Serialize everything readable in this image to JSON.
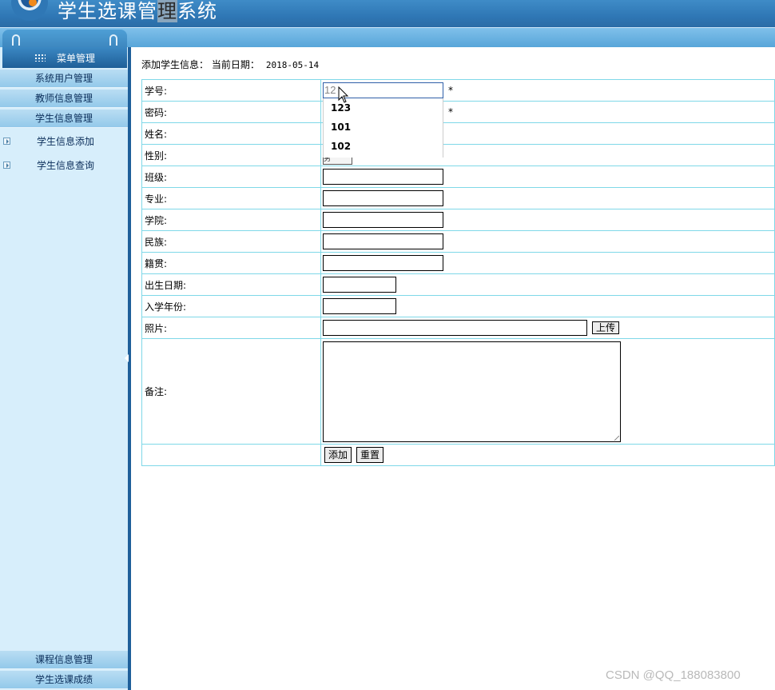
{
  "app": {
    "title_before": "学生选课管",
    "title_highlight": "理",
    "title_after": "系统"
  },
  "sidebar": {
    "menu_header": "菜单管理",
    "items": [
      {
        "label": "系统用户管理"
      },
      {
        "label": "教师信息管理"
      },
      {
        "label": "学生信息管理"
      }
    ],
    "sub_items": [
      {
        "label": "学生信息添加"
      },
      {
        "label": "学生信息查询"
      }
    ],
    "bottom_items": [
      {
        "label": "课程信息管理"
      },
      {
        "label": "学生选课成绩"
      }
    ]
  },
  "page": {
    "breadcrumb": "添加学生信息：",
    "date_label": "当前日期：",
    "date": "2018-05-14"
  },
  "form": {
    "fields": {
      "student_id": {
        "label": "学号:",
        "value": "12",
        "required": "*"
      },
      "password": {
        "label": "密码:",
        "required": "*"
      },
      "name": {
        "label": "姓名:"
      },
      "gender": {
        "label": "性别:",
        "value": "男"
      },
      "class": {
        "label": "班级:"
      },
      "major": {
        "label": "专业:"
      },
      "college": {
        "label": "学院:"
      },
      "ethnicity": {
        "label": "民族:"
      },
      "native_place": {
        "label": "籍贯:"
      },
      "birth_date": {
        "label": "出生日期:"
      },
      "enroll_year": {
        "label": "入学年份:"
      },
      "photo": {
        "label": "照片:",
        "upload_label": "上传"
      },
      "notes": {
        "label": "备注:"
      }
    },
    "submit_label": "添加",
    "reset_label": "重置"
  },
  "autocomplete": {
    "options": [
      "123",
      "101",
      "102"
    ]
  },
  "watermark": "CSDN @QQ_188083800",
  "colors": {
    "header": "#2f77b5",
    "sidebar": "#d7eefb",
    "table_border": "#7fd8e8"
  }
}
